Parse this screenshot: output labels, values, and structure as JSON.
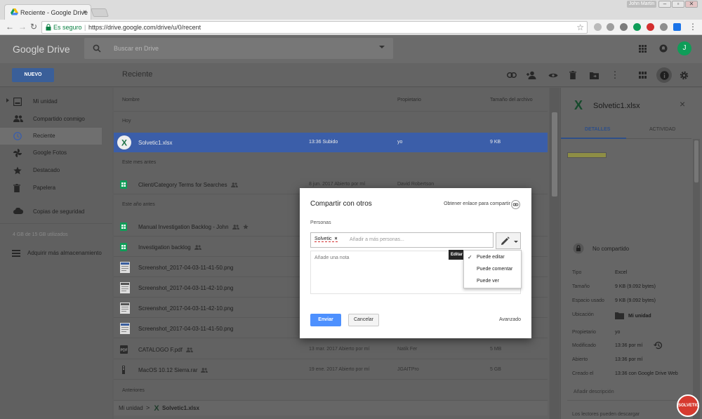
{
  "browser": {
    "tab_title": "Reciente - Google Drive",
    "tab_close": "×",
    "user_chip": "John Martin",
    "secure_label": "Es seguro",
    "url": "https://drive.google.com/drive/u/0/recent"
  },
  "app": {
    "logo": "Google Drive",
    "search_placeholder": "Buscar en Drive",
    "avatar_initial": "J",
    "new_button": "NUEVO",
    "page_title": "Reciente"
  },
  "sidebar": {
    "items": [
      {
        "label": "Mi unidad"
      },
      {
        "label": "Compartido conmigo"
      },
      {
        "label": "Reciente"
      },
      {
        "label": "Google Fotos"
      },
      {
        "label": "Destacado"
      },
      {
        "label": "Papelera"
      },
      {
        "label": "Copias de seguridad"
      }
    ],
    "storage": "4 GB de 15 GB utilizados",
    "buy_storage": "Adquirir más almacenamiento"
  },
  "list": {
    "headers": {
      "name": "Nombre",
      "owner": "Propietario",
      "size": "Tamaño del archivo"
    },
    "sections": [
      "Hoy",
      "Este mes antes",
      "Este año antes",
      "Anteriores"
    ],
    "rows": [
      {
        "name": "Solvetic1.xlsx",
        "date": "13:36 Subido",
        "owner": "yo",
        "size": "9 KB"
      },
      {
        "name": "Client/Category Terms for Searches",
        "date": "8 jun. 2017 Abierto por mí",
        "owner": "David Robertson",
        "size": ""
      },
      {
        "name": "Manual Investigation Backlog - John",
        "date": "",
        "owner": "",
        "size": ""
      },
      {
        "name": "Investigation backlog",
        "date": "",
        "owner": "",
        "size": ""
      },
      {
        "name": "Screenshot_2017-04-03-11-41-50.png",
        "date": "",
        "owner": "",
        "size": ""
      },
      {
        "name": "Screenshot_2017-04-03-11-42-10.png",
        "date": "",
        "owner": "",
        "size": ""
      },
      {
        "name": "Screenshot_2017-04-03-11-42-10.png",
        "date": "",
        "owner": "",
        "size": ""
      },
      {
        "name": "Screenshot_2017-04-03-11-41-50.png",
        "date": "",
        "owner": "",
        "size": ""
      },
      {
        "name": "CATALOGO F.pdf",
        "date": "13 mar. 2017 Abierto por mí",
        "owner": "Natik Fer",
        "size": "5 MB"
      },
      {
        "name": "MacOS 10.12 Sierra.rar",
        "date": "19 ene. 2017 Abierto por mí",
        "owner": "JGAITPro",
        "size": "5 GB"
      }
    ],
    "footer": {
      "root": "Mi unidad",
      "sep": ">",
      "file": "Solvetic1.xlsx"
    }
  },
  "details": {
    "title": "Solvetic1.xlsx",
    "close": "×",
    "tab_details": "DETALLES",
    "tab_activity": "ACTIVIDAD",
    "sharing": "No compartido",
    "props": [
      {
        "k": "Tipo",
        "v": "Excel"
      },
      {
        "k": "Tamaño",
        "v": "9 KB (9.092 bytes)"
      },
      {
        "k": "Espacio usado",
        "v": "9 KB (9.092 bytes)"
      },
      {
        "k": "Ubicación",
        "v": "Mi unidad"
      },
      {
        "k": "Propietario",
        "v": "yo"
      },
      {
        "k": "Modificado",
        "v": "13:36 por mí"
      },
      {
        "k": "Abierto",
        "v": "13:36 por mí"
      },
      {
        "k": "Creado el",
        "v": "13:36 con Google Drive Web"
      }
    ],
    "add_description": "Añadir descripción",
    "readers": "Los lectores pueden descargar"
  },
  "dialog": {
    "title": "Compartir con otros",
    "get_link": "Obtener enlace para compartir",
    "people_label": "Personas",
    "chip": "Solvetic",
    "chip_remove": "×",
    "add_people_placeholder": "Añadir a más personas...",
    "note_placeholder": "Añade una nota",
    "tooltip": "Editar",
    "menu": [
      {
        "check": "✓",
        "label": "Puede editar"
      },
      {
        "check": "",
        "label": "Puede comentar"
      },
      {
        "check": "",
        "label": "Puede ver"
      }
    ],
    "send": "Enviar",
    "cancel": "Cancelar",
    "advanced": "Avanzado"
  },
  "watermark": "SOLVETIC",
  "colors": {
    "accent": "#4d90fe",
    "selected_row": "#3b5ea9",
    "sheets_green": "#0f9d58"
  }
}
